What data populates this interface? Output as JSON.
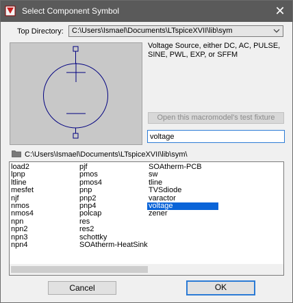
{
  "window": {
    "title": "Select Component Symbol",
    "close_glyph": "✕"
  },
  "top_directory": {
    "label": "Top Directory:",
    "value": "C:\\Users\\Ismael\\Documents\\LTspiceXVII\\lib\\sym"
  },
  "description": "Voltage Source, either DC, AC, PULSE, SINE, PWL, EXP, or SFFM",
  "macro_button_label": "Open this macromodel's test fixture",
  "search": {
    "value": "voltage"
  },
  "current_path": "C:\\Users\\Ismael\\Documents\\LTspiceXVII\\lib\\sym\\",
  "list": {
    "columns": [
      [
        "load2",
        "lpnp",
        "ltline",
        "mesfet",
        "njf",
        "nmos",
        "nmos4",
        "npn",
        "npn2",
        "npn3",
        "npn4"
      ],
      [
        "pjf",
        "pmos",
        "pmos4",
        "pnp",
        "pnp2",
        "pnp4",
        "polcap",
        "res",
        "res2",
        "schottky",
        "SOAtherm-HeatSink"
      ],
      [
        "SOAtherm-PCB",
        "sw",
        "tline",
        "TVSdiode",
        "varactor",
        "voltage",
        "zener"
      ]
    ],
    "selected": "voltage"
  },
  "buttons": {
    "cancel": "Cancel",
    "ok": "OK"
  },
  "colors": {
    "titlebar": "#5a5a5a",
    "selection": "#0a64d8",
    "symbol_stroke": "#000080",
    "accent_border": "#2a7ad5"
  },
  "icons": {
    "app": "ltspice-app-icon",
    "close": "close-icon",
    "dropdown": "chevron-down-icon",
    "folder": "folder-icon"
  }
}
